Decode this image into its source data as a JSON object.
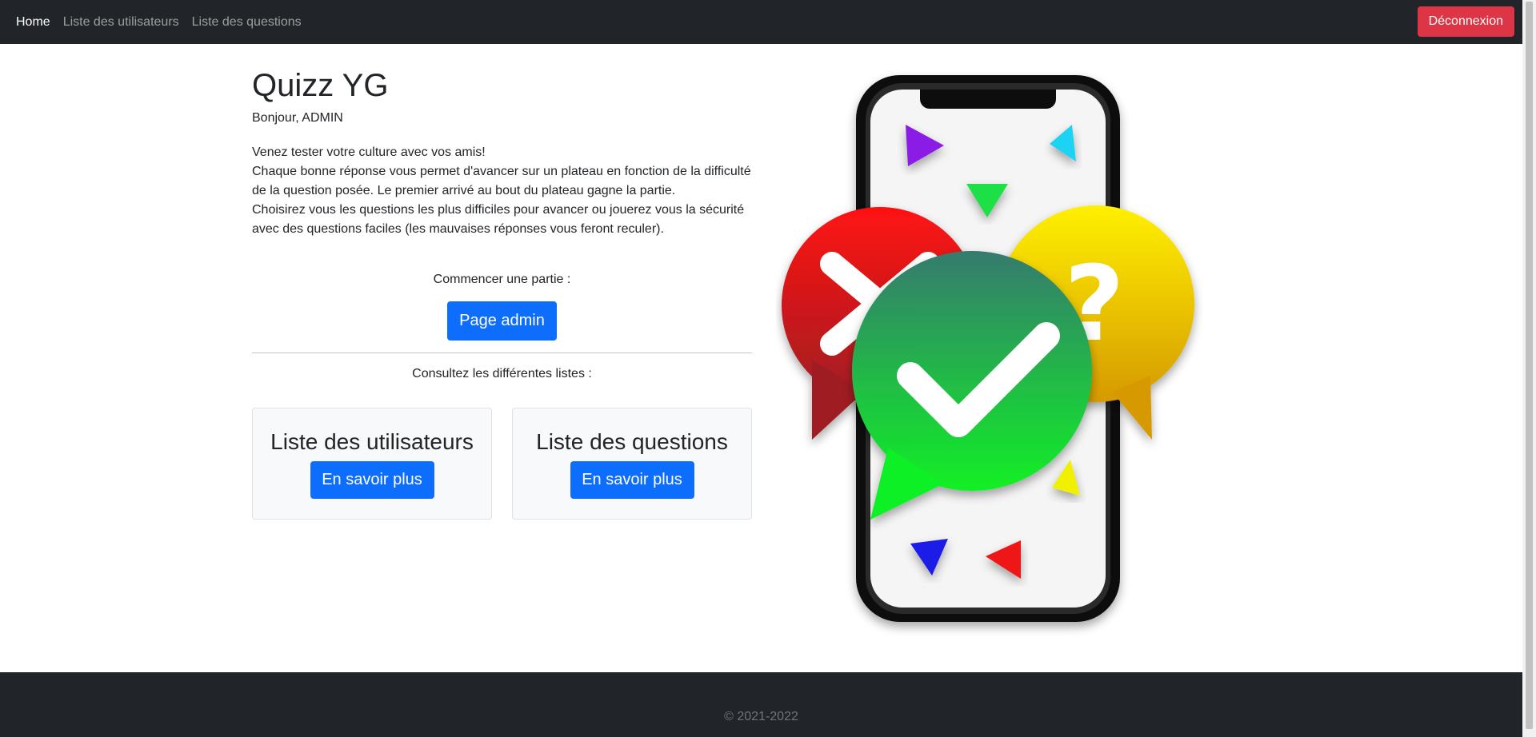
{
  "nav": {
    "home": "Home",
    "users": "Liste des utilisateurs",
    "questions": "Liste des questions",
    "logout": "Déconnexion"
  },
  "main": {
    "title": "Quizz YG",
    "greeting": "Bonjour, ADMIN",
    "intro": [
      "Venez tester votre culture avec vos amis!",
      "Chaque bonne réponse vous permet d'avancer sur un plateau en fonction de la difficulté de la question posée. Le premier arrivé au bout du plateau gagne la partie.",
      "Choisirez vous les questions les plus difficiles pour avancer ou jouerez vous la sécurité avec des questions faciles (les mauvaises réponses vous feront reculer)."
    ],
    "start_label": "Commencer une partie :",
    "admin_button": "Page admin",
    "lists_label": "Consultez les différentes listes :",
    "cards": [
      {
        "title": "Liste des utilisateurs",
        "button": "En savoir plus"
      },
      {
        "title": "Liste des questions",
        "button": "En savoir plus"
      }
    ]
  },
  "footer": {
    "copyright": "© 2021-2022"
  }
}
